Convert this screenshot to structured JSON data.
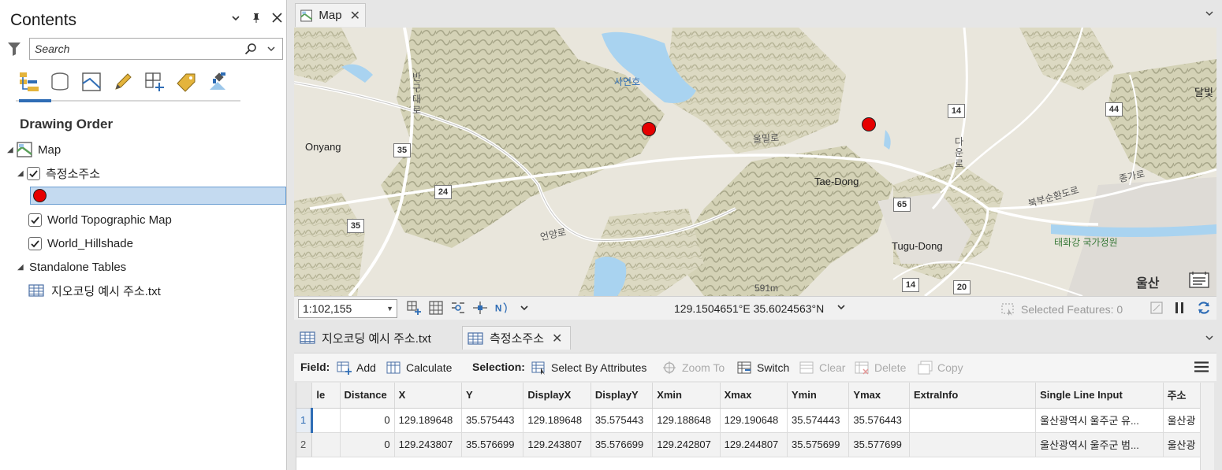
{
  "contents": {
    "title": "Contents",
    "search_placeholder": "Search",
    "section_title": "Drawing Order",
    "tree": {
      "map_label": "Map",
      "layer_points": "측정소주소",
      "layer_topo": "World Topographic Map",
      "layer_hillshade": "World_Hillshade",
      "standalone_label": "Standalone Tables",
      "table_name": "지오코딩 예시 주소.txt"
    }
  },
  "map_tab": {
    "label": "Map"
  },
  "map": {
    "labels": {
      "onyang": "Onyang",
      "taedong": "Tae-Dong",
      "tugudong": "Tugu-Dong",
      "ulsan": "울산",
      "sayeonho": "사연호",
      "ulmillo": "울밀로",
      "eonyangro": "언양로",
      "bangudaero": "반구대로",
      "daeguro": "다운로",
      "jonggaro": "종가로",
      "bukbu": "북부순환도로",
      "taehwagang": "태화강 국가정원",
      "dalbil": "달빛",
      "elev": "591m"
    },
    "shields": {
      "s35a": "35",
      "s35b": "35",
      "s24": "24",
      "s14a": "14",
      "s44": "44",
      "s65": "65",
      "s14b": "14",
      "s20": "20"
    },
    "colors": {
      "land": "#e9e6dc",
      "water": "#a9d3f0",
      "point": "#e60000",
      "relief": "#b9b99a",
      "urban": "#dcd9d4"
    }
  },
  "status": {
    "scale": "1:102,155",
    "coordinates": "129.1504651°E 35.6024563°N",
    "selected_features": "Selected Features: 0"
  },
  "table_tabs": {
    "tab1": "지오코딩 예시 주소.txt",
    "tab2": "측정소주소"
  },
  "toolbar": {
    "field_label": "Field:",
    "add": "Add",
    "calculate": "Calculate",
    "selection_label": "Selection:",
    "select_by_attributes": "Select By Attributes",
    "zoom_to": "Zoom To",
    "switch": "Switch",
    "clear": "Clear",
    "delete": "Delete",
    "copy": "Copy"
  },
  "grid": {
    "columns": [
      "le",
      "Distance",
      "X",
      "Y",
      "DisplayX",
      "DisplayY",
      "Xmin",
      "Xmax",
      "Ymin",
      "Ymax",
      "ExtraInfo",
      "Single Line Input",
      "주소"
    ],
    "rows": [
      {
        "id": "1",
        "cells": [
          "0",
          "129.189648",
          "35.575443",
          "129.189648",
          "35.575443",
          "129.188648",
          "129.190648",
          "35.574443",
          "35.576443",
          "",
          "울산광역시 울주군 유...",
          "울산광"
        ]
      },
      {
        "id": "2",
        "cells": [
          "0",
          "129.243807",
          "35.576699",
          "129.243807",
          "35.576699",
          "129.242807",
          "129.244807",
          "35.575699",
          "35.577699",
          "",
          "울산광역시 울주군 범...",
          "울산광"
        ]
      }
    ]
  }
}
